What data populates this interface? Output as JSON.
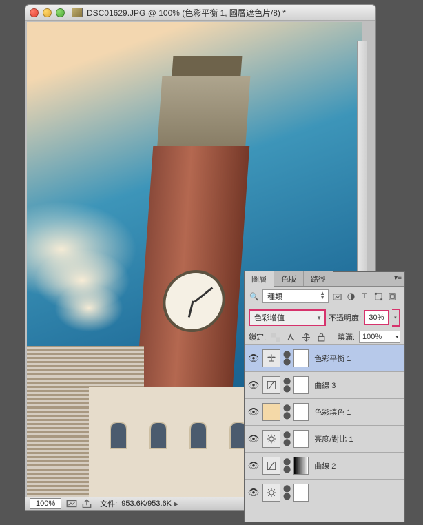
{
  "window": {
    "title": "DSC01629.JPG @ 100% (色彩平衡 1, 圖層遮色片/8) *"
  },
  "statusbar": {
    "zoom": "100%",
    "file_label": "文件:",
    "file_stats": "953.6K/953.6K"
  },
  "panel": {
    "tabs": [
      "圖層",
      "色版",
      "路徑"
    ],
    "kind_label": "種類",
    "blend_mode": "色彩增值",
    "opacity_label": "不透明度:",
    "opacity_value": "30%",
    "lock_label": "鎖定:",
    "fill_label": "填滿:",
    "fill_value": "100%",
    "layers": [
      {
        "name": "色彩平衡 1",
        "icon": "balance"
      },
      {
        "name": "曲線 3",
        "icon": "curves"
      },
      {
        "name": "色彩填色 1",
        "icon": "colorfill"
      },
      {
        "name": "亮度/對比 1",
        "icon": "brightness"
      },
      {
        "name": "曲線 2",
        "icon": "curves"
      }
    ]
  }
}
